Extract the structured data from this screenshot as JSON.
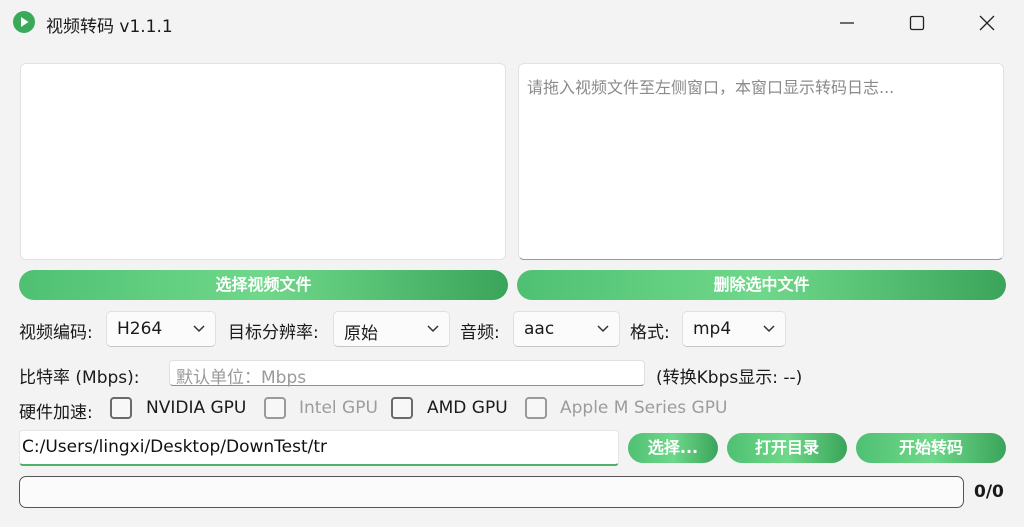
{
  "window": {
    "title": "视频转码 v1.1.1",
    "icon": "play-icon",
    "controls": [
      "minimize-icon",
      "maximize-icon",
      "close-icon"
    ]
  },
  "log": {
    "placeholder": "请拖入视频文件至左侧窗口，本窗口显示转码日志..."
  },
  "buttons": {
    "select_video": "选择视频文件",
    "delete_selected": "删除选中文件",
    "choose": "选择...",
    "open_dir": "打开目录",
    "start": "开始转码"
  },
  "settings": {
    "video_codec": {
      "label": "视频编码:",
      "value": "H264"
    },
    "resolution": {
      "label": "目标分辨率:",
      "value": "原始"
    },
    "audio": {
      "label": "音频:",
      "value": "aac"
    },
    "format": {
      "label": "格式:",
      "value": "mp4"
    }
  },
  "bitrate": {
    "label": "比特率 (Mbps):",
    "placeholder": "默认单位：Mbps",
    "kbps_note": "(转换Kbps显示: --)"
  },
  "hardware": {
    "label": "硬件加速:",
    "options": [
      {
        "label": "NVIDIA GPU",
        "enabled": true,
        "checked": false
      },
      {
        "label": "Intel GPU",
        "enabled": false,
        "checked": false
      },
      {
        "label": "AMD GPU",
        "enabled": true,
        "checked": false
      },
      {
        "label": "Apple M Series GPU",
        "enabled": false,
        "checked": false
      }
    ]
  },
  "output": {
    "path": "C:/Users/lingxi/Desktop/DownTest/tr"
  },
  "progress": {
    "fraction": 0,
    "count": "0/0"
  },
  "colors": {
    "accent": "#4fc072",
    "accent_dark": "#3aa55a",
    "background": "#f3f3f3"
  }
}
